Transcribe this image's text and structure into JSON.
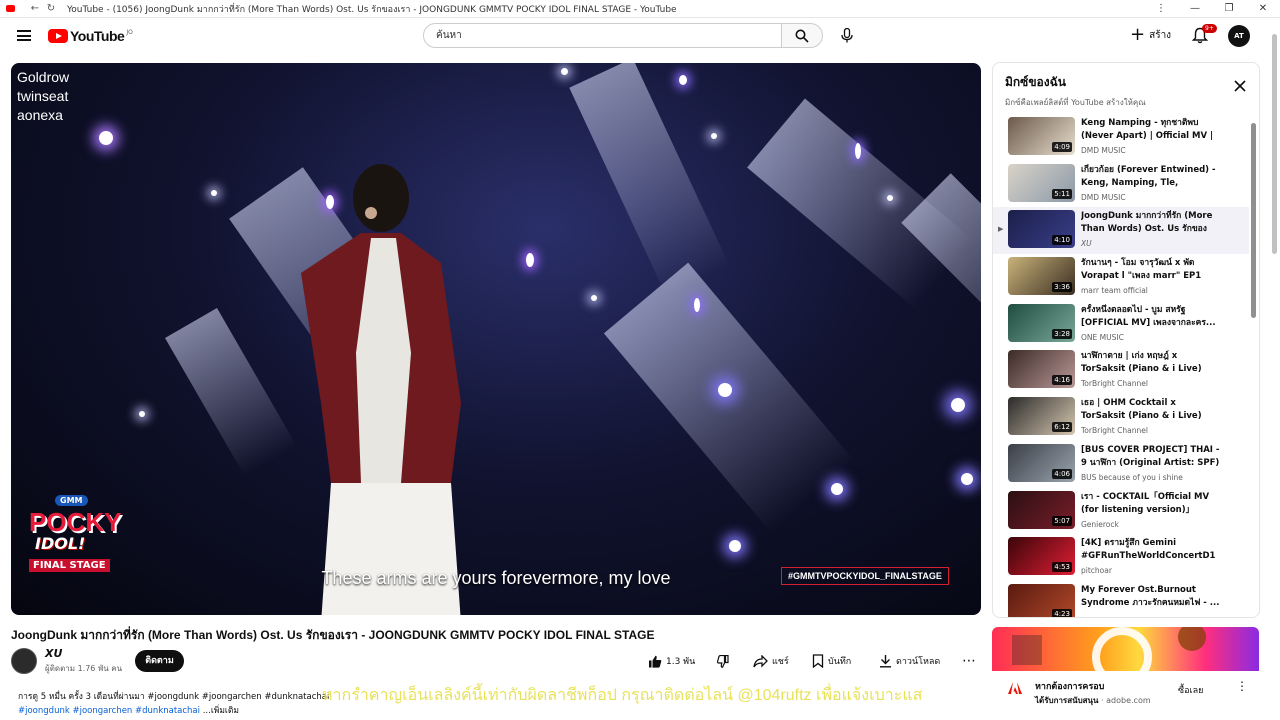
{
  "window": {
    "title": "YouTube - (1056) JoongDunk มากกว่าที่รัก (More Than Words) Ost. Us รักของเรา - JOONGDUNK GMMTV POCKY IDOL FINAL STAGE - YouTube"
  },
  "masthead": {
    "logo_text": "YouTube",
    "country": "JO",
    "search_placeholder": "ค้นหา",
    "create_label": "สร้าง",
    "notifications_badge": "9+",
    "account_initials": "AT"
  },
  "player": {
    "watermark_lines": [
      "Goldrow",
      "twinseat",
      "aonexa"
    ],
    "subtitle": "These arms are yours forevermore, my love",
    "hashtag": "#GMMTVPOCKYIDOL_FINALSTAGE",
    "logo": {
      "gmm": "GMM",
      "pocky": "POCKY",
      "idol": "IDOL!",
      "final": "FINAL STAGE"
    }
  },
  "video": {
    "title": "JoongDunk มากกว่าที่รัก (More Than Words) Ost. Us รักของเรา - JOONGDUNK GMMTV POCKY IDOL FINAL STAGE",
    "channel_name": "XU",
    "subscribers": "ผู้ติดตาม 1.76 พัน คน",
    "subscribe_label": "ติดตาม",
    "likes": "1.3 พัน",
    "share_label": "แชร์",
    "save_label": "บันทึก",
    "download_label": "ดาวน์โหลด",
    "description_line1": "การดู 5 หมื่น ครั้ง  3 เดือนที่ผ่านมา  #joongdunk #joongarchen #dunknatachai",
    "description_tags": "#joongdunk #joongarchen #dunknatachai",
    "description_more": "...เพิ่มเติม"
  },
  "overlay": {
    "text": "หากรำคาญเอ็นเลลิงค์นี้เท่ากับผิดลาชีพก็อป กรุณาติดต่อไลน์ @104ruftz เพื่อแจ้งเบาะแส"
  },
  "playlist": {
    "title": "มิกซ์ของฉัน",
    "subtitle": "มิกซ์คือเพลย์ลิสต์ที่ YouTube สร้างให้คุณ",
    "items": [
      {
        "title": "Keng Namping - ทุกชาติพบ (Never Apart) | Official MV | ...",
        "channel": "DMD MUSIC",
        "duration": "4:09",
        "active": false
      },
      {
        "title": "เกี่ยวก้อย (Forever Entwined) - Keng, Namping, Tle, FirstOne ...",
        "channel": "DMD MUSIC",
        "duration": "5:11",
        "active": false
      },
      {
        "title": "JoongDunk มากกว่าที่รัก (More Than Words) Ost. Us รักของเร...",
        "channel": "XU",
        "duration": "4:10",
        "active": true
      },
      {
        "title": "รักนานๆ - โอม จารุวัฒน์ x พัด Vorapat l \"เพลง marr\" EP1",
        "channel": "marr team official",
        "duration": "3:36",
        "active": false
      },
      {
        "title": "ครั้งหนึ่งตลอดไป - บูม สหรัฐ [OFFICIAL MV] เพลงจากละคร...",
        "channel": "ONE MUSIC",
        "duration": "3:28",
        "active": false
      },
      {
        "title": "นาฬิกาตาย | เก่ง หฤษฎ์ x TorSaksit (Piano & i Live)",
        "channel": "TorBright Channel",
        "duration": "4:16",
        "active": false
      },
      {
        "title": "เธอ | OHM Cocktail x TorSaksit (Piano & i Live)",
        "channel": "TorBright Channel",
        "duration": "6:12",
        "active": false
      },
      {
        "title": "[BUS COVER PROJECT] THAI - 9 นาฬิกา (Original Artist: SPF)",
        "channel": "BUS because of you i shine",
        "duration": "4:06",
        "active": false
      },
      {
        "title": "เรา - COCKTAIL「Official MV (for listening version)」",
        "channel": "Genierock",
        "duration": "5:07",
        "active": false
      },
      {
        "title": "[4K] ดรามรู้สึก Gemini #GFRunTheWorldConcertD1",
        "channel": "pitchoar",
        "duration": "4:53",
        "active": false
      },
      {
        "title": "My Forever Ost.Burnout Syndrome ภาวะรักคนหมดไฟ - ...",
        "channel": "",
        "duration": "4:23",
        "active": false
      }
    ]
  },
  "ad": {
    "headline": "หากต้องการครอบ",
    "sponsor_label": "ได้รับการสนับสนุน",
    "domain": "adobe.com",
    "cta": "ซื้อเลย"
  },
  "colors": {
    "brand_red": "#ff0000",
    "link_blue": "#065fd4"
  }
}
